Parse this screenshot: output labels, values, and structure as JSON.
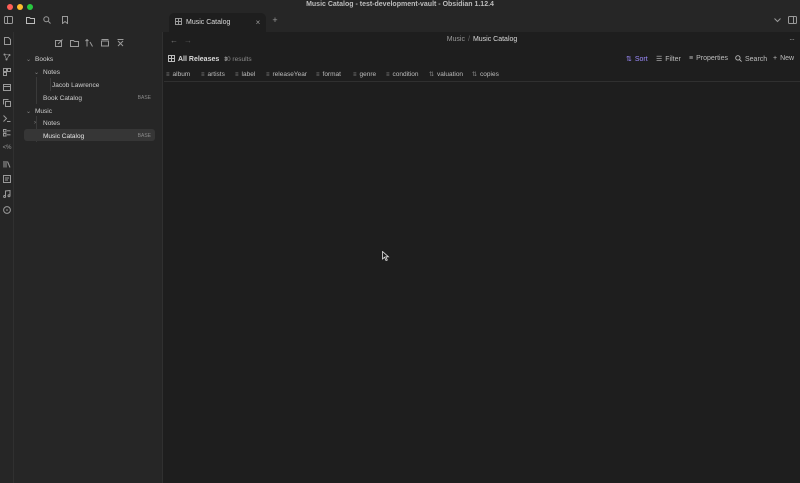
{
  "window": {
    "title": "Music Catalog - test-development-vault - Obsidian 1.12.4"
  },
  "toolbar": {
    "icons": [
      "sidebar-toggle-icon",
      "folder-open-icon",
      "search-icon",
      "bookmark-icon"
    ],
    "new_tab_label": "+",
    "right_icons": [
      "chevron-down-icon",
      "right-sidebar-toggle-icon"
    ]
  },
  "tab": {
    "label": "Music Catalog",
    "close_label": "×",
    "icon": "table-icon"
  },
  "ribbon": {
    "icons": [
      "file-icon",
      "graph-icon",
      "canvas-icon",
      "calendar-icon",
      "copy-icon",
      "terminal-icon",
      "checklist-icon",
      "template-icon",
      "library-icon",
      "note-icon",
      "music-icon",
      "help-icon"
    ]
  },
  "sidebar": {
    "tools": [
      "new-note-icon",
      "new-folder-icon",
      "sort-icon",
      "collapse-icon",
      "close-all-icon"
    ],
    "tree": [
      {
        "label": "Books",
        "type": "folder",
        "expanded": true
      },
      {
        "label": "Notes",
        "type": "folder",
        "expanded": true
      },
      {
        "label": "Jacob Lawrence",
        "type": "file"
      },
      {
        "label": "Book Catalog",
        "type": "file",
        "badge": "BASE"
      },
      {
        "label": "Music",
        "type": "folder",
        "expanded": true
      },
      {
        "label": "Notes",
        "type": "folder",
        "expanded": false
      },
      {
        "label": "Music Catalog",
        "type": "file",
        "badge": "BASE",
        "active": true
      }
    ]
  },
  "breadcrumb": {
    "parent": "Music",
    "separator": "/",
    "current": "Music Catalog",
    "more": "···"
  },
  "base": {
    "view_name": "All Releases",
    "results": "0 results",
    "actions": {
      "sort": "Sort",
      "filter": "Filter",
      "properties": "Properties",
      "search": "Search",
      "new": "New"
    },
    "columns": [
      {
        "label": "album",
        "kind": "text"
      },
      {
        "label": "artists",
        "kind": "text"
      },
      {
        "label": "label",
        "kind": "text"
      },
      {
        "label": "releaseYear",
        "kind": "text"
      },
      {
        "label": "format",
        "kind": "text"
      },
      {
        "label": "genre",
        "kind": "text"
      },
      {
        "label": "condition",
        "kind": "text"
      },
      {
        "label": "valuation",
        "kind": "number"
      },
      {
        "label": "copies",
        "kind": "number"
      }
    ]
  },
  "colors": {
    "accent": "#9d8cff",
    "background": "#1e1e1e",
    "panel": "#262626"
  }
}
